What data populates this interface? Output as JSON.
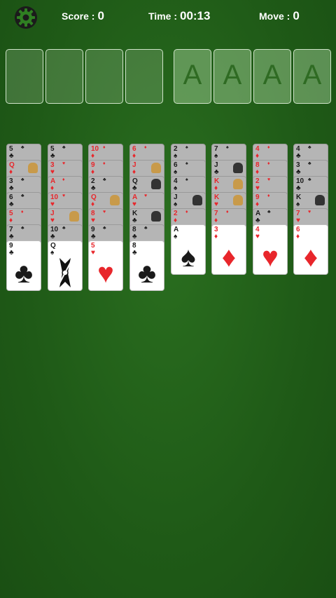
{
  "header": {
    "score_label": "Score :",
    "score_value": "0",
    "time_label": "Time :",
    "time_value": "00:13",
    "move_label": "Move :",
    "move_value": "0"
  },
  "foundations": [
    "A",
    "A",
    "A",
    "A"
  ],
  "columns": [
    [
      [
        "5",
        "♣"
      ],
      [
        "Q",
        "♦"
      ],
      [
        "3",
        "♣"
      ],
      [
        "6",
        "♣"
      ],
      [
        "5",
        "♦"
      ],
      [
        "7",
        "♣"
      ],
      [
        "9",
        "♣"
      ]
    ],
    [
      [
        "5",
        "♣"
      ],
      [
        "3",
        "♥"
      ],
      [
        "A",
        "♦"
      ],
      [
        "10",
        "♥"
      ],
      [
        "J",
        "♥"
      ],
      [
        "10",
        "♣"
      ],
      [
        "Q",
        "♠"
      ]
    ],
    [
      [
        "10",
        "♦"
      ],
      [
        "9",
        "♦"
      ],
      [
        "2",
        "♣"
      ],
      [
        "Q",
        "♦"
      ],
      [
        "8",
        "♥"
      ],
      [
        "9",
        "♣"
      ],
      [
        "5",
        "♥"
      ]
    ],
    [
      [
        "6",
        "♦"
      ],
      [
        "J",
        "♦"
      ],
      [
        "Q",
        "♣"
      ],
      [
        "A",
        "♥"
      ],
      [
        "K",
        "♣"
      ],
      [
        "8",
        "♣"
      ],
      [
        "8",
        "♣"
      ]
    ],
    [
      [
        "2",
        "♠"
      ],
      [
        "6",
        "♠"
      ],
      [
        "4",
        "♠"
      ],
      [
        "J",
        "♠"
      ],
      [
        "2",
        "♦"
      ],
      [
        "A",
        "♠"
      ]
    ],
    [
      [
        "7",
        "♠"
      ],
      [
        "J",
        "♣"
      ],
      [
        "K",
        "♦"
      ],
      [
        "K",
        "♥"
      ],
      [
        "7",
        "♦"
      ],
      [
        "3",
        "♦"
      ]
    ],
    [
      [
        "4",
        "♦"
      ],
      [
        "8",
        "♦"
      ],
      [
        "2",
        "♥"
      ],
      [
        "9",
        "♦"
      ],
      [
        "A",
        "♣"
      ],
      [
        "4",
        "♥"
      ]
    ],
    [
      [
        "4",
        "♣"
      ],
      [
        "3",
        "♣"
      ],
      [
        "10",
        "♣"
      ],
      [
        "K",
        "♠"
      ],
      [
        "7",
        "♥"
      ],
      [
        "6",
        "♦"
      ]
    ]
  ],
  "colors": {
    "felt": "#1f5a17",
    "red_suit": "#e8262b",
    "black_suit": "#1a1a1a"
  }
}
